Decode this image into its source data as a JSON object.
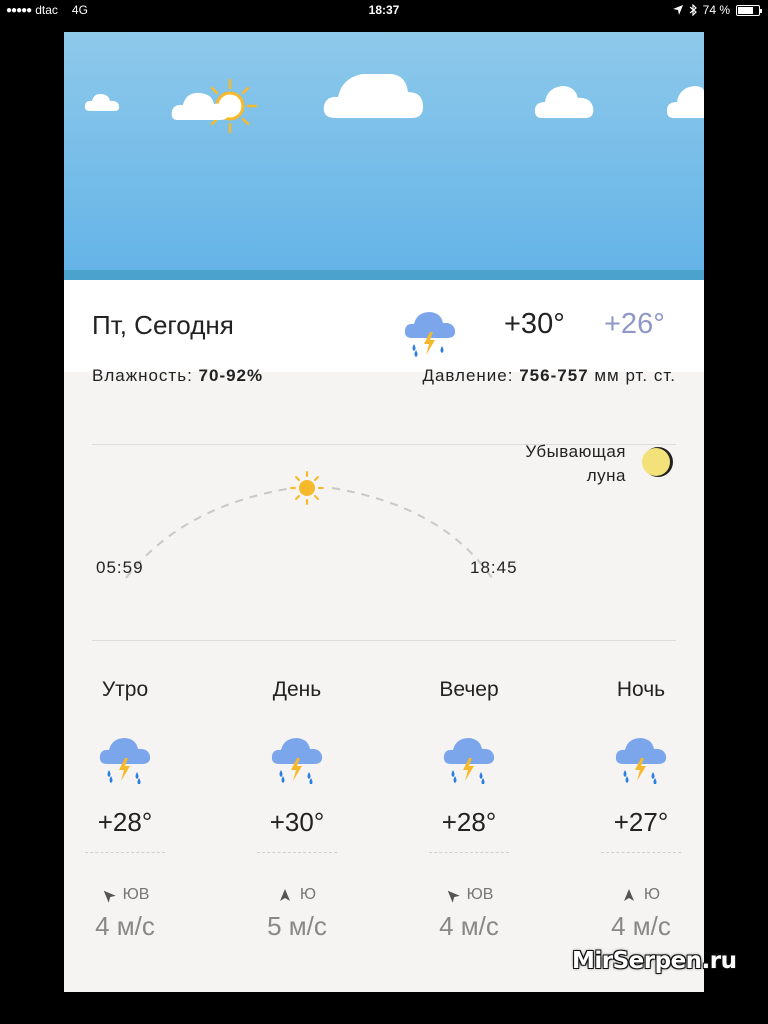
{
  "statusbar": {
    "carrier": "dtac",
    "network": "4G",
    "time": "18:37",
    "battery": "74 %",
    "battery_level": 0.74
  },
  "today": {
    "label": "Пт, Сегодня",
    "icon": "thunderstorm-rain-icon",
    "temp_high": "+30°",
    "temp_low": "+26°"
  },
  "details": {
    "humidity_label": "Влажность:",
    "humidity_value": "70-92%",
    "pressure_label": "Давление:",
    "pressure_value": "756-757",
    "pressure_unit": "мм рт. ст."
  },
  "sun": {
    "sunrise": "05:59",
    "sunset": "18:45"
  },
  "moon": {
    "phase_line1": "Убывающая",
    "phase_line2": "луна"
  },
  "periods": [
    {
      "name": "Утро",
      "temp": "+28°",
      "wind_dir": "ЮВ",
      "wind_speed": "4 м/с",
      "icon": "thunderstorm-rain-icon"
    },
    {
      "name": "День",
      "temp": "+30°",
      "wind_dir": "Ю",
      "wind_speed": "5 м/с",
      "icon": "thunderstorm-rain-icon"
    },
    {
      "name": "Вечер",
      "temp": "+28°",
      "wind_dir": "ЮВ",
      "wind_speed": "4 м/с",
      "icon": "thunderstorm-rain-icon"
    },
    {
      "name": "Ночь",
      "temp": "+27°",
      "wind_dir": "Ю",
      "wind_speed": "4 м/с",
      "icon": "thunderstorm-rain-icon"
    }
  ],
  "watermark": "MirSerpen.ru",
  "colors": {
    "sky_top": "#8ec9ea",
    "sky_bottom": "#63b3e8",
    "low_temp": "#8f97c8",
    "sun": "#f6b92b",
    "rain": "#2a7fe0"
  }
}
